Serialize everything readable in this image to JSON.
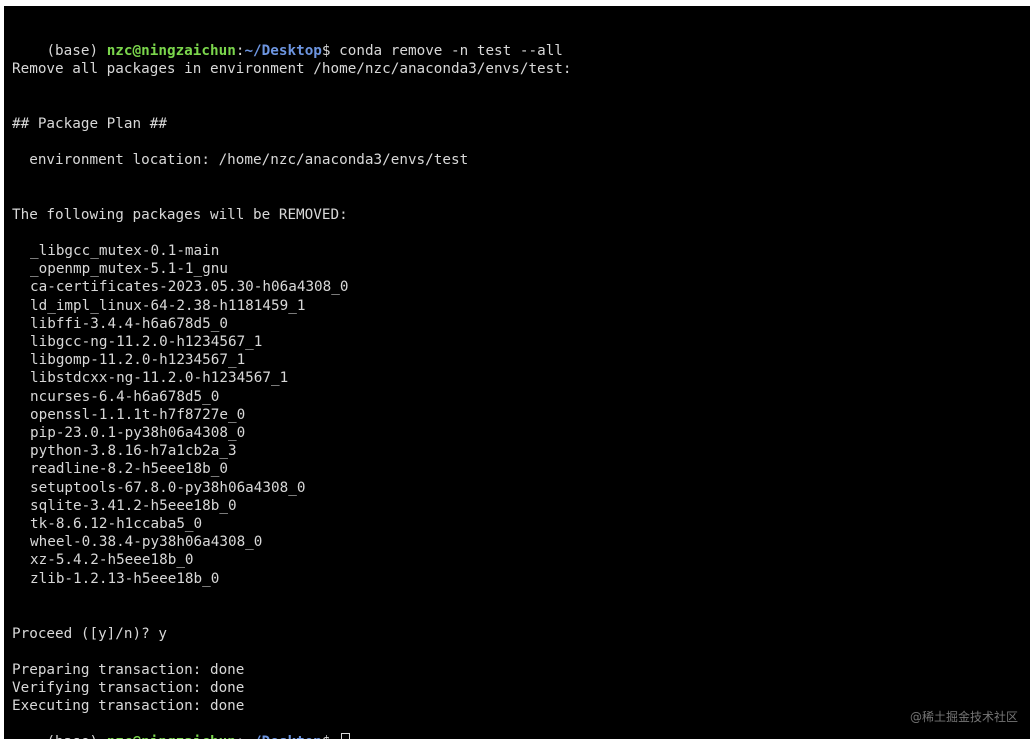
{
  "prompt": {
    "env": "(base) ",
    "user_host": "nzc@ningzaichun",
    "sep": ":",
    "path": "~/Desktop",
    "dollar": "$ "
  },
  "command": "conda remove -n test --all",
  "remove_msg": "Remove all packages in environment /home/nzc/anaconda3/envs/test:",
  "plan_header": "## Package Plan ##",
  "env_location": "  environment location: /home/nzc/anaconda3/envs/test",
  "removed_header": "The following packages will be REMOVED:",
  "packages": [
    "_libgcc_mutex-0.1-main",
    "_openmp_mutex-5.1-1_gnu",
    "ca-certificates-2023.05.30-h06a4308_0",
    "ld_impl_linux-64-2.38-h1181459_1",
    "libffi-3.4.4-h6a678d5_0",
    "libgcc-ng-11.2.0-h1234567_1",
    "libgomp-11.2.0-h1234567_1",
    "libstdcxx-ng-11.2.0-h1234567_1",
    "ncurses-6.4-h6a678d5_0",
    "openssl-1.1.1t-h7f8727e_0",
    "pip-23.0.1-py38h06a4308_0",
    "python-3.8.16-h7a1cb2a_3",
    "readline-8.2-h5eee18b_0",
    "setuptools-67.8.0-py38h06a4308_0",
    "sqlite-3.41.2-h5eee18b_0",
    "tk-8.6.12-h1ccaba5_0",
    "wheel-0.38.4-py38h06a4308_0",
    "xz-5.4.2-h5eee18b_0",
    "zlib-1.2.13-h5eee18b_0"
  ],
  "proceed": "Proceed ([y]/n)? y",
  "steps": [
    "Preparing transaction: done",
    "Verifying transaction: done",
    "Executing transaction: done"
  ],
  "watermark": "@稀土掘金技术社区",
  "colors": {
    "background": "#000000",
    "text": "#d8d8d8",
    "user_host": "#7bd64c",
    "path": "#6d95e0"
  }
}
